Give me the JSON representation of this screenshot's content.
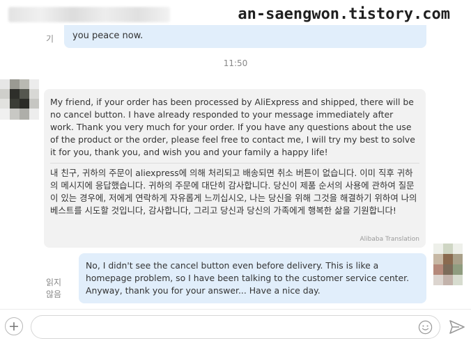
{
  "header": {
    "watermark": "an-saengwon.tistory.com"
  },
  "messages": {
    "prev_outgoing_tail": "you peace now.",
    "prev_read_mark": "기",
    "timestamp": "11:50",
    "incoming": {
      "english": "My friend, if your order has been processed by AliExpress and shipped, there will be no cancel button. I have already responded to your message immediately after work. Thank you very much for your order. If you have any questions about the use of the product or the order, please feel free to contact me, I will try my best to solve it for you, thank you, and wish you and your family a happy life!",
      "korean": "내 친구, 귀하의 주문이 aliexpress에 의해 처리되고 배송되면 취소 버튼이 없습니다. 이미 직후 귀하의 메시지에 응답했습니다. 귀하의 주문에 대단히 감사합니다. 당신이 제품 순서의 사용에 관하여 질문이 있는 경우에, 저에게 연락하게 자유롭게 느끼십시오, 나는 당신을 위해 그것을 해결하기 위하여 나의 베스트를 시도할 것입니다, 감사합니다, 그리고 당신과 당신의 가족에게 행복한 삶을 기원합니다!",
      "translation_note": "Alibaba Translation"
    },
    "outgoing": {
      "text": "No, I didn't see the cancel button even before delivery. This is like a homepage problem, so I have been talking to the customer service center. Anyway, thank you for your answer... Have a nice day.",
      "read_mark": "읽지 않음"
    }
  },
  "composer": {
    "input_value": "",
    "input_placeholder": "",
    "add_icon": "plus-icon",
    "emoji_icon": "smiley-icon",
    "send_icon": "send-icon"
  },
  "colors": {
    "outgoing_bubble": "#e1eefb",
    "incoming_bubble": "#f2f2f2",
    "meta_text": "#888888"
  }
}
